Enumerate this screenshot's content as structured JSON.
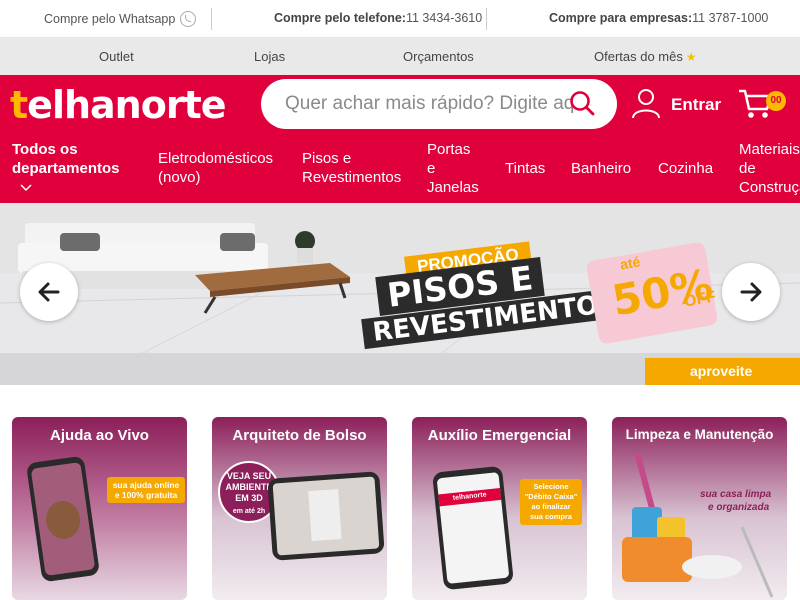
{
  "topbar": {
    "whatsapp_label": "Compre pelo Whatsapp",
    "phone_label": "Compre pelo telefone:",
    "phone_number": "11 3434-3610",
    "business_label": "Compre para empresas:",
    "business_number": "11 3787-1000"
  },
  "subbar": {
    "links": [
      "Outlet",
      "Lojas",
      "Orçamentos",
      "Ofertas do mês"
    ]
  },
  "header": {
    "logo_text": "telhanorte",
    "search_placeholder": "Quer achar mais rápido? Digite aqui",
    "login_label": "Entrar",
    "cart_count": "00"
  },
  "nav": {
    "all_departments": [
      "Todos os",
      "departamentos"
    ],
    "categories": [
      [
        "Eletrodomésticos",
        "(novo)"
      ],
      [
        "Pisos e",
        "Revestimentos"
      ],
      [
        "Portas",
        "e",
        "Janelas"
      ],
      [
        "Tintas"
      ],
      [
        "Banheiro"
      ],
      [
        "Cozinha"
      ],
      [
        "Materiais",
        "de",
        "Construção"
      ]
    ]
  },
  "banner": {
    "promo_label": "PROMOÇÃO",
    "headline1": "PISOS E",
    "headline2": "REVESTIMENTOS",
    "tag_prefix": "até",
    "tag_percent": "50%",
    "tag_suffix": "OFF",
    "cta": "aproveite"
  },
  "cards": [
    {
      "title": "Ajuda ao Vivo",
      "tag": "sua ajuda online e 100% gratuita"
    },
    {
      "title": "Arquiteto de Bolso",
      "badge": "VEJA SEU AMBIENTE EM 3D",
      "badge_sub": "em até 2h"
    },
    {
      "title": "Auxílio Emergencial",
      "tag": "Selecione \"Débito Caixa\" ao finalizar sua compra",
      "phone_brand": "telhanorte"
    },
    {
      "title": "Limpeza e Manutenção",
      "tag_line1": "sua casa limpa",
      "tag_line2": "e organizada"
    }
  ],
  "colors": {
    "brand_red": "#e0003c",
    "accent_yellow": "#f5a800",
    "card_purple": "#8c1f5a"
  }
}
